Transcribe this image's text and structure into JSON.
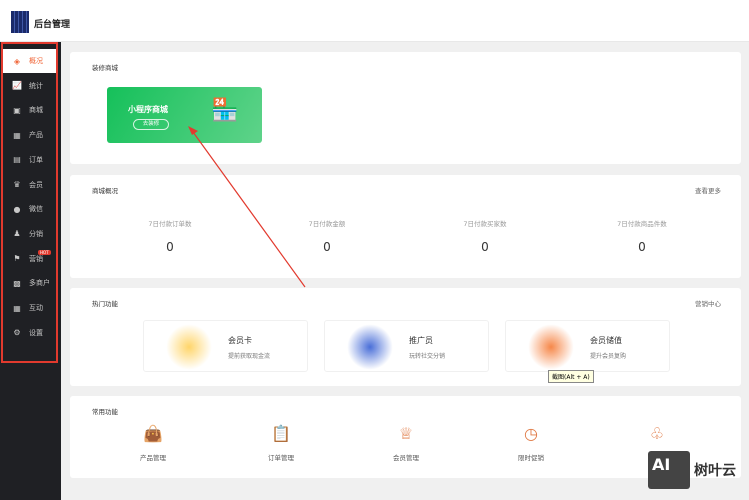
{
  "header": {
    "title": "后台管理"
  },
  "sidebar": {
    "items": [
      {
        "label": "概况",
        "icon": "layers-icon",
        "glyph": "◈"
      },
      {
        "label": "统计",
        "icon": "chart-icon",
        "glyph": "📈"
      },
      {
        "label": "商城",
        "icon": "store-icon",
        "glyph": "▣"
      },
      {
        "label": "产品",
        "icon": "grid-icon",
        "glyph": "▦"
      },
      {
        "label": "订单",
        "icon": "clipboard-icon",
        "glyph": "▤"
      },
      {
        "label": "会员",
        "icon": "crown-icon",
        "glyph": "♛"
      },
      {
        "label": "微信",
        "icon": "wechat-icon",
        "glyph": "●"
      },
      {
        "label": "分销",
        "icon": "user-icon",
        "glyph": "♟"
      },
      {
        "label": "营销",
        "icon": "flag-icon",
        "glyph": "⚑",
        "badge": "HOT"
      },
      {
        "label": "多商户",
        "icon": "shop-icon",
        "glyph": "▩"
      },
      {
        "label": "互动",
        "icon": "apps-icon",
        "glyph": "▦"
      },
      {
        "label": "设置",
        "icon": "gear-icon",
        "glyph": "⚙"
      }
    ]
  },
  "decorate": {
    "title": "装修商城",
    "tile_title": "小程序商城",
    "tile_button": "去装修"
  },
  "overview": {
    "title": "商城概况",
    "more": "查看更多",
    "stats": [
      {
        "label": "7日付款订单数",
        "value": "0"
      },
      {
        "label": "7日付款金额",
        "value": "0"
      },
      {
        "label": "7日付款买家数",
        "value": "0"
      },
      {
        "label": "7日付款商品件数",
        "value": "0"
      }
    ]
  },
  "hot": {
    "title": "热门功能",
    "more": "营销中心",
    "items": [
      {
        "name": "会员卡",
        "desc": "提前获取现金流"
      },
      {
        "name": "推广员",
        "desc": "玩转社交分销"
      },
      {
        "name": "会员储值",
        "desc": "提升会员复购"
      }
    ]
  },
  "common": {
    "title": "常用功能",
    "items": [
      {
        "label": "产品管理",
        "glyph": "👜"
      },
      {
        "label": "订单管理",
        "glyph": "📋"
      },
      {
        "label": "会员管理",
        "glyph": "♕"
      },
      {
        "label": "限时促销",
        "glyph": "◷"
      },
      {
        "label": "",
        "glyph": "♧"
      }
    ]
  },
  "tooltip": "截图(Alt + A)",
  "watermark": {
    "logo": "AI",
    "text": "树叶云"
  },
  "colors": {
    "accent": "#f0673a",
    "sidebar": "#1f2024",
    "green": "#15c05a",
    "annotation": "#e23a2e"
  }
}
